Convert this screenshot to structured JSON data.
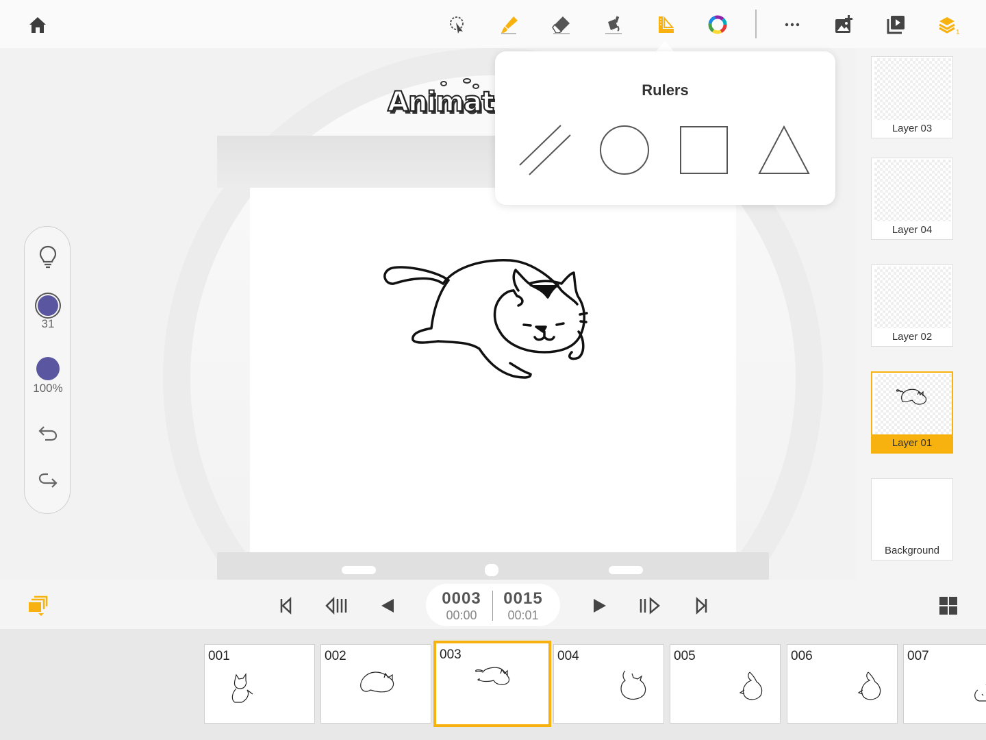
{
  "toolbar": {
    "home_icon": "home-icon",
    "tools": [
      "lasso-select-icon",
      "brush-icon",
      "eraser-icon",
      "fill-bucket-icon",
      "ruler-icon",
      "color-wheel-icon"
    ],
    "more_icon": "more-icon",
    "right": [
      "add-image-icon",
      "playback-icon",
      "layers-icon"
    ],
    "accent": "#f7b20f",
    "layers_badge": "1"
  },
  "logo_text": "Animatio",
  "rulers_popup": {
    "title": "Rulers",
    "options": [
      "parallel-lines-ruler",
      "circle-ruler",
      "square-ruler",
      "triangle-ruler"
    ]
  },
  "side_tools": {
    "brush_size": "31",
    "opacity": "100%",
    "brush_color": "#5a57a0"
  },
  "layers": [
    {
      "label": "Layer 03",
      "active": false
    },
    {
      "label": "Layer 04",
      "active": false
    },
    {
      "label": "Layer 02",
      "active": false
    },
    {
      "label": "Layer 01",
      "active": true
    },
    {
      "label": "Background",
      "active": false
    }
  ],
  "playback": {
    "current_frame": "0003",
    "current_time": "00:00",
    "total_frames": "0015",
    "total_time": "00:01"
  },
  "frames": [
    "001",
    "002",
    "003",
    "004",
    "005",
    "006",
    "007"
  ],
  "active_frame": "003"
}
